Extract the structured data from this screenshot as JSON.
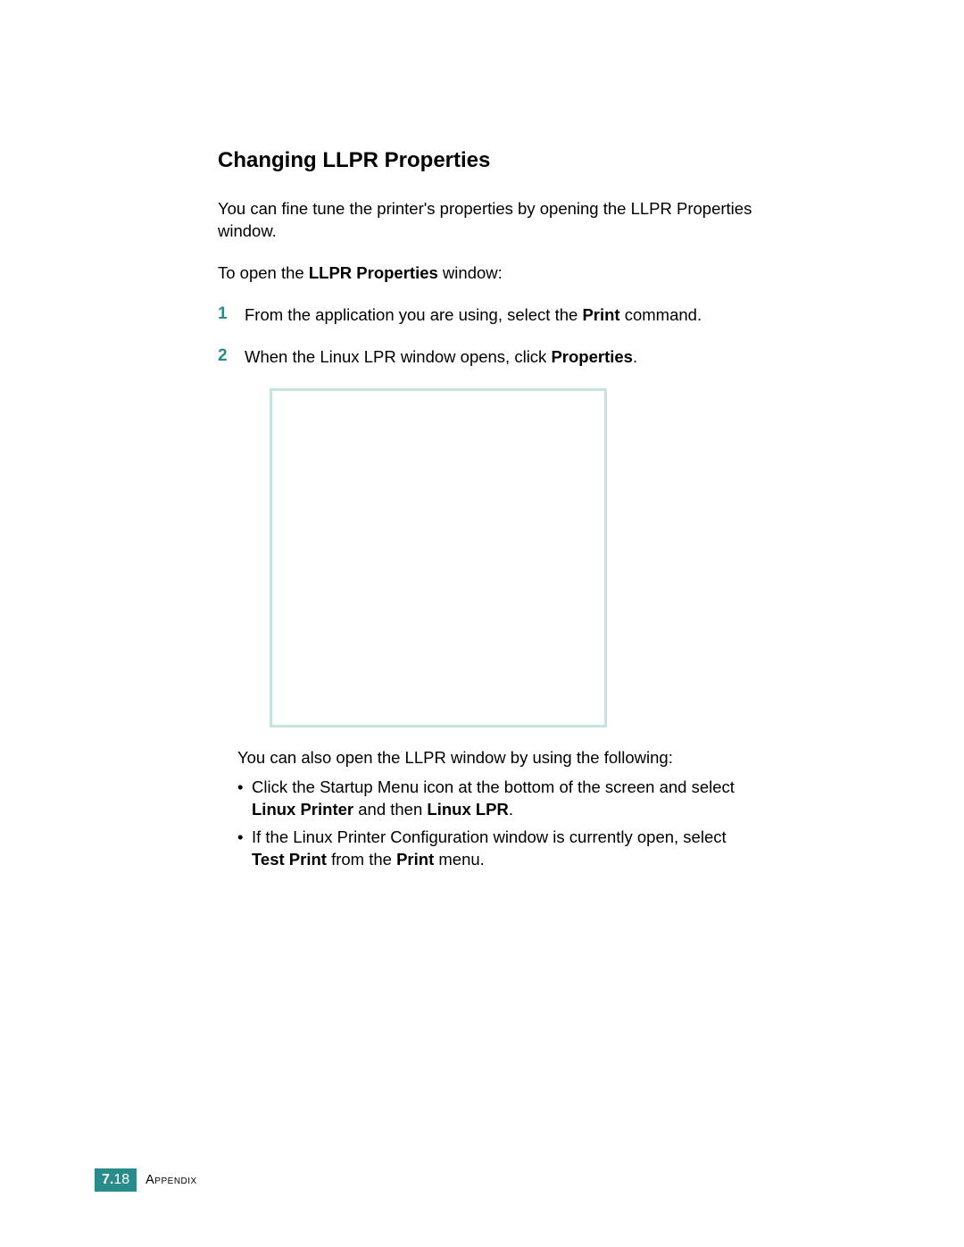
{
  "heading": "Changing LLPR Properties",
  "intro": "You can fine tune the printer's properties by opening the LLPR Properties window.",
  "open_prefix": "To open the ",
  "open_bold": "LLPR Properties",
  "open_suffix": " window:",
  "steps": [
    {
      "num": "1",
      "parts": [
        {
          "t": "From the application you are using, select the ",
          "b": false
        },
        {
          "t": "Print",
          "b": true
        },
        {
          "t": " command.",
          "b": false
        }
      ]
    },
    {
      "num": "2",
      "parts": [
        {
          "t": "When the Linux LPR window opens, click ",
          "b": false
        },
        {
          "t": "Properties",
          "b": true
        },
        {
          "t": ".",
          "b": false
        }
      ]
    }
  ],
  "also_text": "You can also open the LLPR window by using the following:",
  "bullets": [
    [
      {
        "t": "Click the Startup Menu icon at the bottom of the screen and select ",
        "b": false
      },
      {
        "t": "Linux Printer",
        "b": true
      },
      {
        "t": " and then ",
        "b": false
      },
      {
        "t": "Linux LPR",
        "b": true
      },
      {
        "t": ".",
        "b": false
      }
    ],
    [
      {
        "t": "If the Linux Printer Configuration window is currently open, select ",
        "b": false
      },
      {
        "t": "Test Print",
        "b": true
      },
      {
        "t": " from the ",
        "b": false
      },
      {
        "t": "Print",
        "b": true
      },
      {
        "t": " menu.",
        "b": false
      }
    ]
  ],
  "footer": {
    "chapter": "7.",
    "page": "18",
    "label": "Appendix"
  }
}
